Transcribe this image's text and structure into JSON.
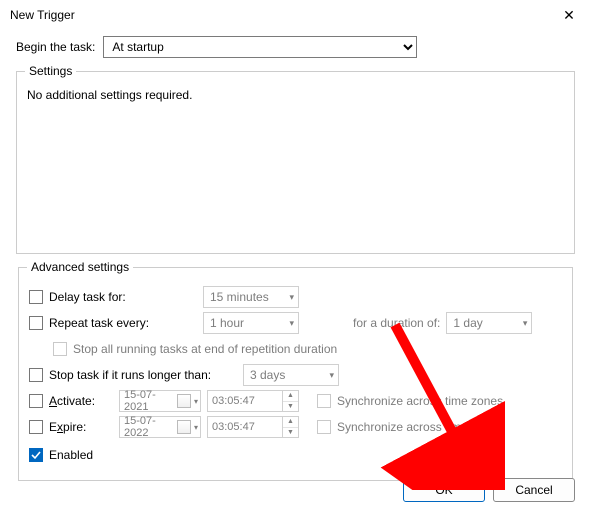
{
  "window": {
    "title": "New Trigger"
  },
  "begin": {
    "label": "Begin the task:",
    "selected": "At startup"
  },
  "settings": {
    "legend": "Settings",
    "message": "No additional settings required."
  },
  "adv": {
    "legend": "Advanced settings",
    "delay": {
      "label": "Delay task for:",
      "value": "15 minutes",
      "checked": false
    },
    "repeat": {
      "label": "Repeat task every:",
      "value": "1 hour",
      "checked": false,
      "durationLabel": "for a duration of:",
      "durationValue": "1 day"
    },
    "stopAll": {
      "label": "Stop all running tasks at end of repetition duration",
      "checked": false
    },
    "stopLonger": {
      "label": "Stop task if it runs longer than:",
      "value": "3 days",
      "checked": false
    },
    "activate": {
      "label": "Activate:",
      "date": "15-07-2021",
      "time": "03:05:47",
      "syncLabel": "Synchronize across time zones",
      "checked": false,
      "syncChecked": false
    },
    "expire": {
      "label": "Expire:",
      "date": "15-07-2022",
      "time": "03:05:47",
      "syncLabel": "Synchronize across time zones",
      "checked": false,
      "syncChecked": false
    },
    "enabled": {
      "label": "Enabled",
      "checked": true
    }
  },
  "buttons": {
    "ok": "OK",
    "cancel": "Cancel"
  }
}
